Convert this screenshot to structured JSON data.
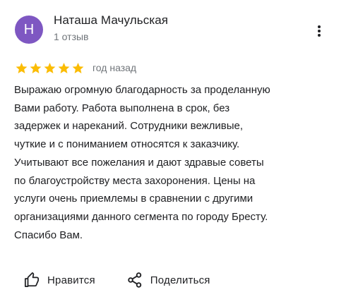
{
  "review": {
    "author_initial": "Н",
    "author_name": "Наташа Мачульская",
    "reviews_count": "1 отзыв",
    "rating": 5,
    "rating_max": 5,
    "date": "год назад",
    "text": "Выражаю огромную благодарность за проделанную\nВами работу. Работа выполнена в срок, без\nзадержек и нареканий. Сотрудники вежливые,\nчуткие и с пониманием относятся к заказчику.\nУчитывают  все пожелания и дают здравые советы\nпо благоустройству места захоронения. Цены на\nуслуги очень приемлемы в сравнении с другими\nорганизациями данного сегмента по городу Бресту.\nСпасибо Вам."
  },
  "actions": {
    "like_label": "Нравится",
    "share_label": "Поделиться"
  },
  "icons": {
    "more": "more-vert-icon",
    "star": "star-icon",
    "like": "thumb-up-icon",
    "share": "share-icon"
  },
  "colors": {
    "avatar_bg": "#7e57c2",
    "star": "#fbbc04",
    "secondary_text": "#70757a",
    "primary_text": "#202124"
  }
}
